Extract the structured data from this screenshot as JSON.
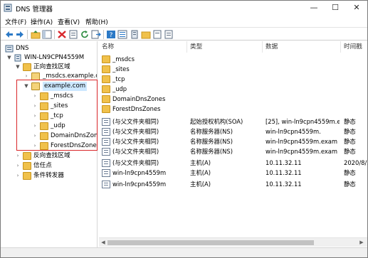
{
  "window": {
    "title": "DNS 管理器",
    "controls": {
      "minimize": "—",
      "maximize": "☐",
      "close": "✕"
    }
  },
  "menu": [
    "文件(F)",
    "操作(A)",
    "查看(V)",
    "帮助(H)"
  ],
  "toolbar": {
    "icons": [
      "back-icon",
      "forward-icon",
      "folder-up-icon",
      "console-tree-icon",
      "delete-icon",
      "properties-icon",
      "refresh-icon",
      "export-icon",
      "help-icon",
      "list-view-icon",
      "server-icon",
      "folder-icon",
      "zone-icon",
      "record-icon"
    ]
  },
  "tree": {
    "root": "DNS",
    "server": "WIN-LN9CPN4559M",
    "forward_zones": "正向查找区域",
    "msdcs_zone": "_msdcs.example.co",
    "selected_zone": "example.com",
    "zone_children": [
      "_msdcs",
      "_sites",
      "_tcp",
      "_udp",
      "DomainDnsZone",
      "ForestDnsZone"
    ],
    "reverse_zones": "反向查找区域",
    "trust_points": "信任点",
    "conditional_forwarders": "条件转发器"
  },
  "list": {
    "columns": [
      "名称",
      "类型",
      "数据",
      "时间戳"
    ],
    "rows": [
      {
        "name": "_msdcs",
        "type": "",
        "data": "",
        "timestamp": "",
        "icon": "folder"
      },
      {
        "name": "_sites",
        "type": "",
        "data": "",
        "timestamp": "",
        "icon": "folder"
      },
      {
        "name": "_tcp",
        "type": "",
        "data": "",
        "timestamp": "",
        "icon": "folder"
      },
      {
        "name": "_udp",
        "type": "",
        "data": "",
        "timestamp": "",
        "icon": "folder"
      },
      {
        "name": "DomainDnsZones",
        "type": "",
        "data": "",
        "timestamp": "",
        "icon": "folder"
      },
      {
        "name": "ForestDnsZones",
        "type": "",
        "data": "",
        "timestamp": "",
        "icon": "folder"
      },
      {
        "name": "(与父文件夹相同)",
        "type": "起始授权机构(SOA)",
        "data": "[25], win-ln9cpn4559m.exa",
        "timestamp": "静态",
        "icon": "record"
      },
      {
        "name": "(与父文件夹相同)",
        "type": "名称服务器(NS)",
        "data": "win-ln9cpn4559m.",
        "timestamp": "静态",
        "icon": "record"
      },
      {
        "name": "(与父文件夹相同)",
        "type": "名称服务器(NS)",
        "data": "win-ln9cpn4559m.exam",
        "timestamp": "静态",
        "icon": "record"
      },
      {
        "name": "(与父文件夹相同)",
        "type": "名称服务器(NS)",
        "data": "win-ln9cpn4559m.exam",
        "timestamp": "静态",
        "icon": "record"
      },
      {
        "name": "(与父文件夹相同)",
        "type": "主机(A)",
        "data": "10.11.32.11",
        "timestamp": "2020/8/2",
        "icon": "record"
      },
      {
        "name": "win-ln9cpn4559m",
        "type": "主机(A)",
        "data": "10.11.32.11",
        "timestamp": "静态",
        "icon": "record"
      },
      {
        "name": "win-ln9cpn4559m",
        "type": "主机(A)",
        "data": "10.11.32.11",
        "timestamp": "静态",
        "icon": "record"
      }
    ]
  },
  "colors": {
    "selection": "#cce8ff",
    "highlight_box": "#d9262a",
    "folder": "#f0c14b"
  }
}
